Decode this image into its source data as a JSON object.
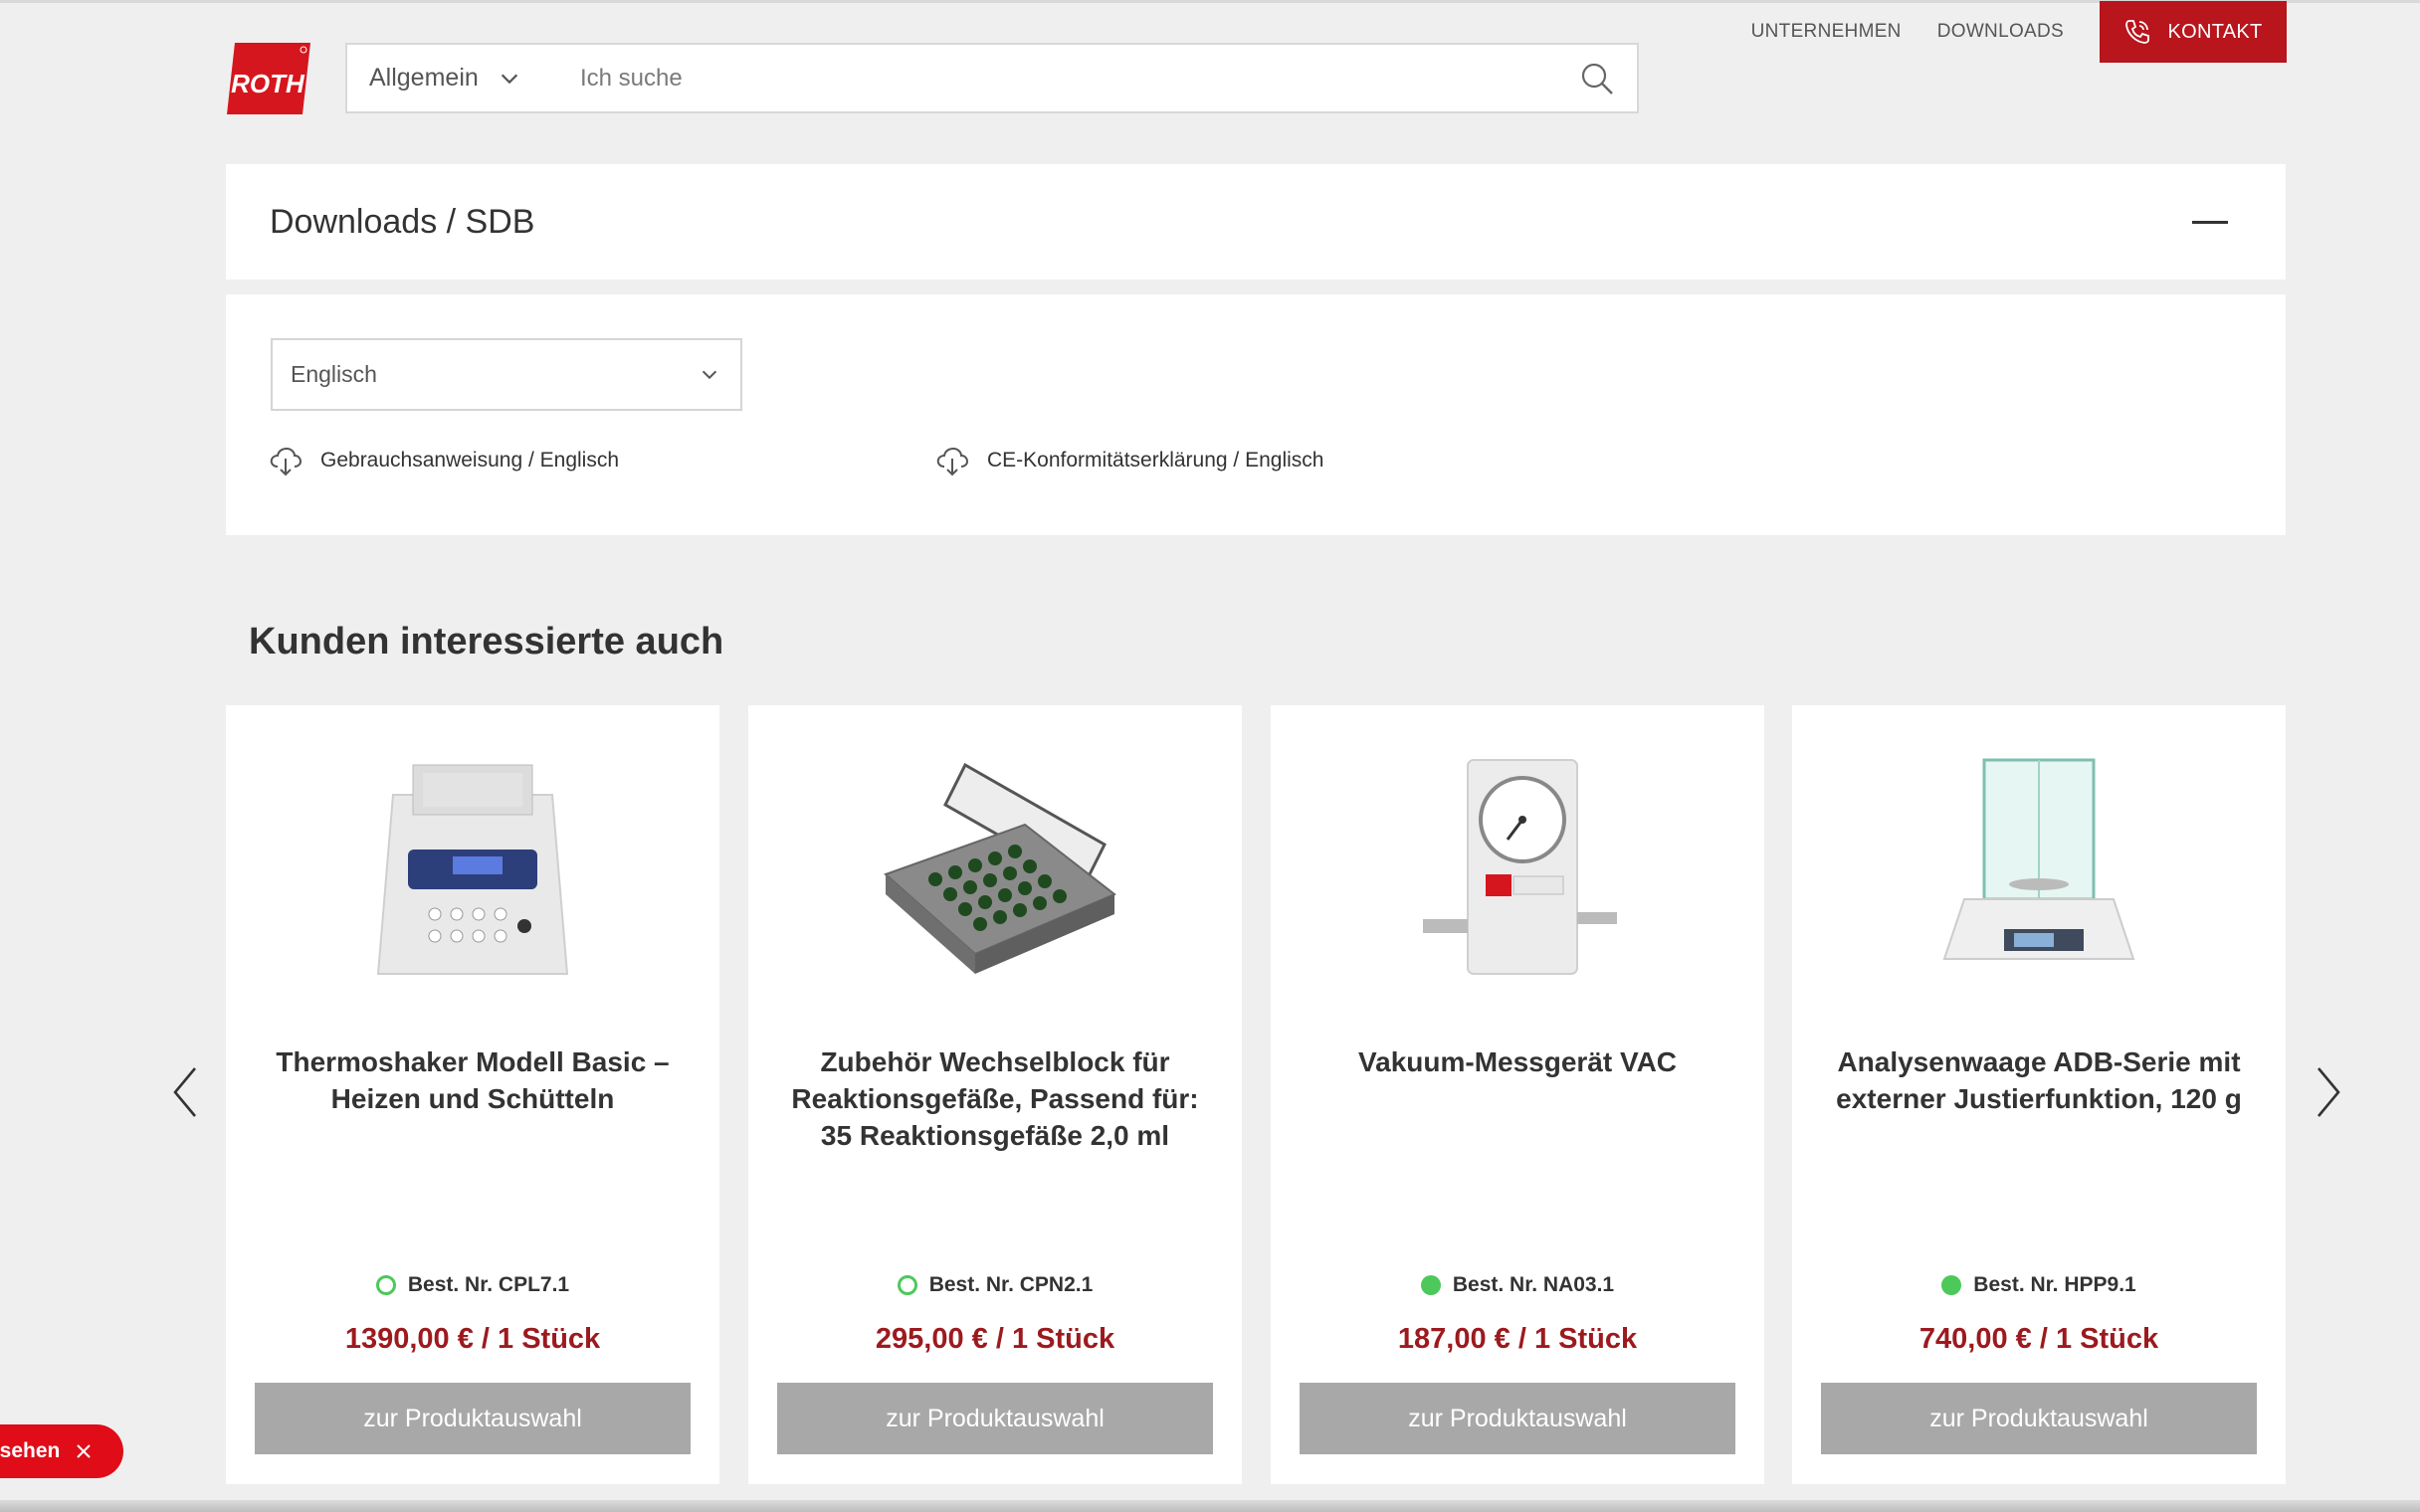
{
  "header": {
    "logo_text": "ROTH",
    "search": {
      "category": "Allgemein",
      "placeholder": "Ich suche"
    },
    "nav": {
      "company": "UNTERNEHMEN",
      "downloads": "DOWNLOADS",
      "contact": "KONTAKT"
    }
  },
  "downloads": {
    "title": "Downloads / SDB",
    "language": "Englisch",
    "files": [
      {
        "label": "Gebrauchsanweisung / Englisch"
      },
      {
        "label": "CE-Konformitätserklärung / Englisch"
      }
    ]
  },
  "recommendations": {
    "title": "Kunden interessierte auch",
    "products": [
      {
        "name": "Thermoshaker Modell Basic – Heizen und Schütteln",
        "order": "Best. Nr. CPL7.1",
        "availability": "open",
        "price": "1390,00 €  / 1 Stück",
        "button": "zur Produktauswahl"
      },
      {
        "name": "Zubehör Wechselblock für Reaktionsgefäße, Passend für: 35 Reaktionsgefäße 2,0 ml",
        "order": "Best. Nr. CPN2.1",
        "availability": "open",
        "price": "295,00 €  / 1 Stück",
        "button": "zur Produktauswahl"
      },
      {
        "name": "Vakuum-Messgerät VAC",
        "order": "Best. Nr. NA03.1",
        "availability": "available",
        "price": "187,00 €  / 1 Stück",
        "button": "zur Produktauswahl"
      },
      {
        "name": "Analysenwaage ADB-Serie mit externer Justierfunktion, 120 g",
        "order": "Best. Nr. HPP9.1",
        "availability": "available",
        "price": "740,00 €  / 1 Stück",
        "button": "zur Produktauswahl"
      }
    ]
  },
  "toast": {
    "label": "esehen"
  },
  "colors": {
    "brand": "#b8151d",
    "price": "#9c1a1e",
    "available": "#4cc95a",
    "button_gray": "#a8a8a8"
  }
}
